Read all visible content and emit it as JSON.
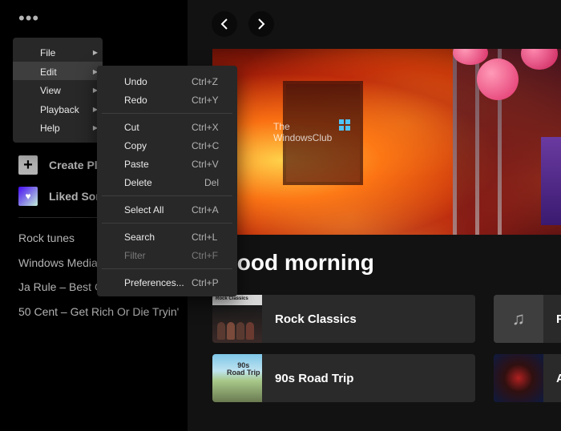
{
  "sidebar": {
    "more_icon": "more-horizontal-icon",
    "create_playlist": "Create Playlist",
    "liked_songs": "Liked Songs",
    "playlists": [
      "Rock tunes",
      "Windows Media Player",
      "Ja Rule – Best Of",
      "50 Cent – Get Rich Or Die Tryin'"
    ]
  },
  "nav": {
    "back_icon": "chevron-left-icon",
    "forward_icon": "chevron-right-icon"
  },
  "banner": {
    "watermark_line1": "The",
    "watermark_line2": "WindowsClub"
  },
  "main": {
    "greeting": "Good morning",
    "cards": [
      {
        "title": "Rock Classics",
        "art_label": "Rock Classics"
      },
      {
        "title": "R"
      },
      {
        "title": "90s Road Trip",
        "art_label1": "90s",
        "art_label2": "Road Trip"
      },
      {
        "title": "A"
      }
    ]
  },
  "menu": {
    "items": [
      {
        "label": "File"
      },
      {
        "label": "Edit"
      },
      {
        "label": "View"
      },
      {
        "label": "Playback"
      },
      {
        "label": "Help"
      }
    ]
  },
  "edit_menu": {
    "items": [
      {
        "label": "Undo",
        "shortcut": "Ctrl+Z"
      },
      {
        "label": "Redo",
        "shortcut": "Ctrl+Y"
      },
      {
        "label": "Cut",
        "shortcut": "Ctrl+X"
      },
      {
        "label": "Copy",
        "shortcut": "Ctrl+C"
      },
      {
        "label": "Paste",
        "shortcut": "Ctrl+V"
      },
      {
        "label": "Delete",
        "shortcut": "Del"
      },
      {
        "label": "Select All",
        "shortcut": "Ctrl+A"
      },
      {
        "label": "Search",
        "shortcut": "Ctrl+L"
      },
      {
        "label": "Filter",
        "shortcut": "Ctrl+F"
      },
      {
        "label": "Preferences...",
        "shortcut": "Ctrl+P"
      }
    ]
  },
  "colors": {
    "accent": "#1db954",
    "menu_bg": "#282828",
    "highlight": "#3e3e3e"
  }
}
